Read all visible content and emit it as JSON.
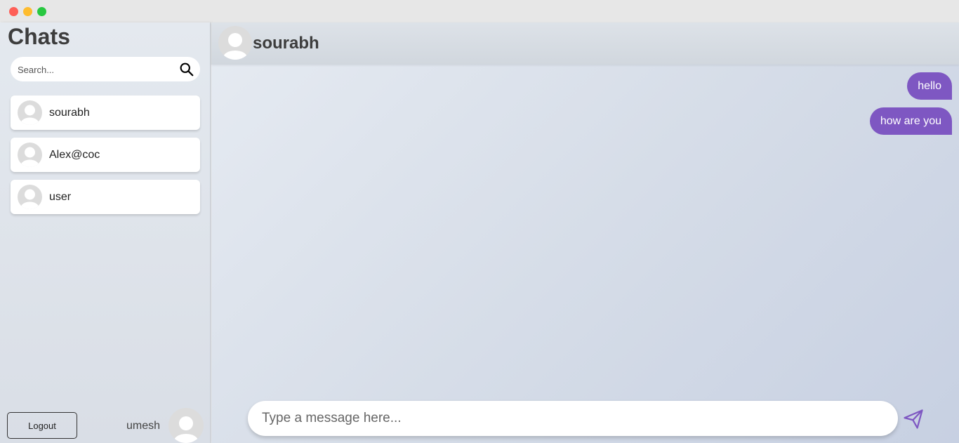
{
  "sidebar": {
    "title": "Chats",
    "search": {
      "placeholder": "Search...",
      "value": ""
    },
    "chats": [
      {
        "name": "sourabh"
      },
      {
        "name": "Alex@coc"
      },
      {
        "name": "user"
      }
    ],
    "logout_label": "Logout",
    "current_user": "umesh"
  },
  "conversation": {
    "contact_name": "sourabh",
    "messages": [
      {
        "text": "hello",
        "direction": "outgoing"
      },
      {
        "text": "how are you",
        "direction": "outgoing"
      }
    ],
    "composer": {
      "placeholder": "Type a message here...",
      "value": ""
    }
  },
  "colors": {
    "accent": "#7e57c2",
    "traffic_close": "#fe5f57",
    "traffic_minimize": "#febc2e",
    "traffic_maximize": "#28c840"
  },
  "icons": {
    "search": "search-icon",
    "send": "send-icon",
    "avatar": "user-avatar-icon"
  }
}
